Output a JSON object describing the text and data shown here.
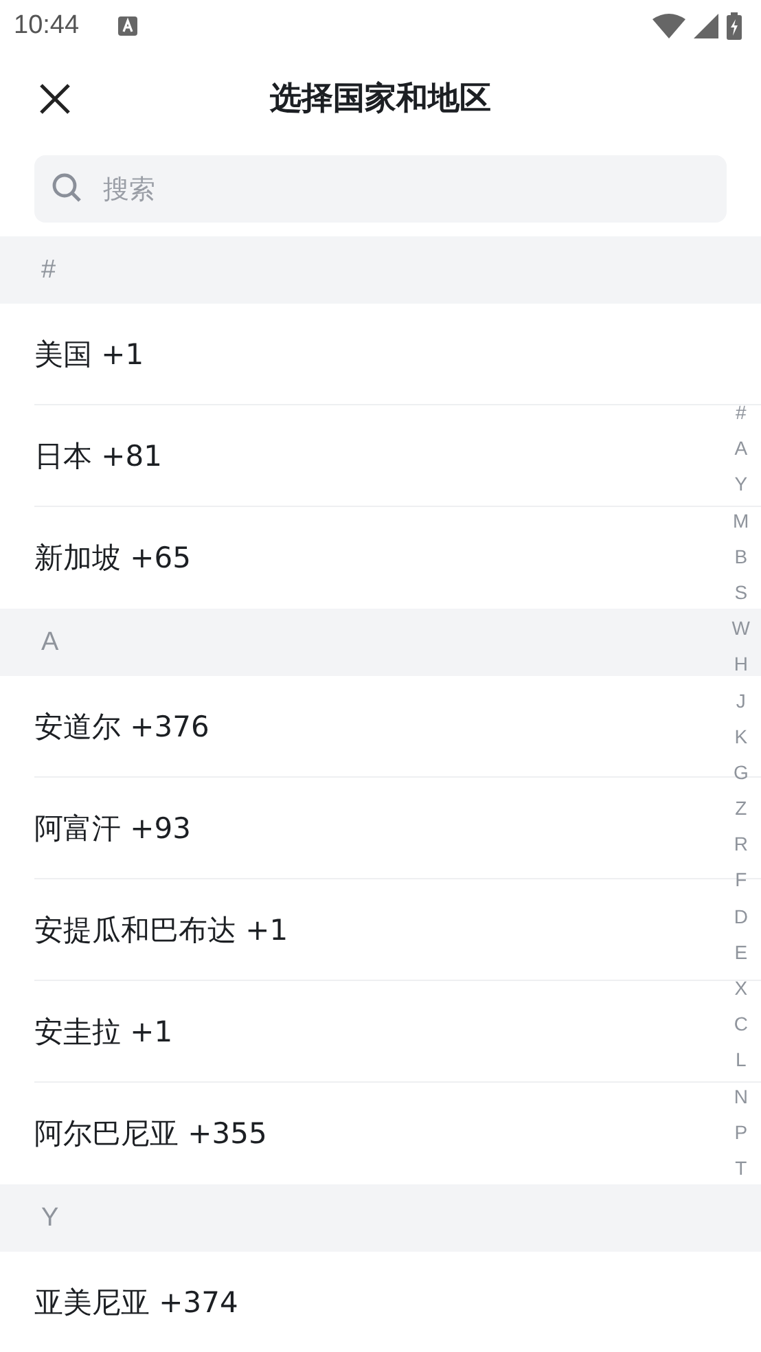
{
  "status_bar": {
    "time": "10:44"
  },
  "header": {
    "title": "选择国家和地区"
  },
  "search": {
    "placeholder": "搜索"
  },
  "sections": [
    {
      "letter": "#",
      "items": [
        "美国 +1",
        "日本 +81",
        "新加坡 +65"
      ]
    },
    {
      "letter": "A",
      "items": [
        "安道尔 +376",
        "阿富汗 +93",
        "安提瓜和巴布达 +1",
        "安圭拉 +1",
        "阿尔巴尼亚 +355"
      ]
    },
    {
      "letter": "Y",
      "items": [
        "亚美尼亚 +374"
      ]
    }
  ],
  "index": [
    "#",
    "A",
    "Y",
    "M",
    "B",
    "S",
    "W",
    "H",
    "J",
    "K",
    "G",
    "Z",
    "R",
    "F",
    "D",
    "E",
    "X",
    "C",
    "L",
    "N",
    "P",
    "T"
  ]
}
